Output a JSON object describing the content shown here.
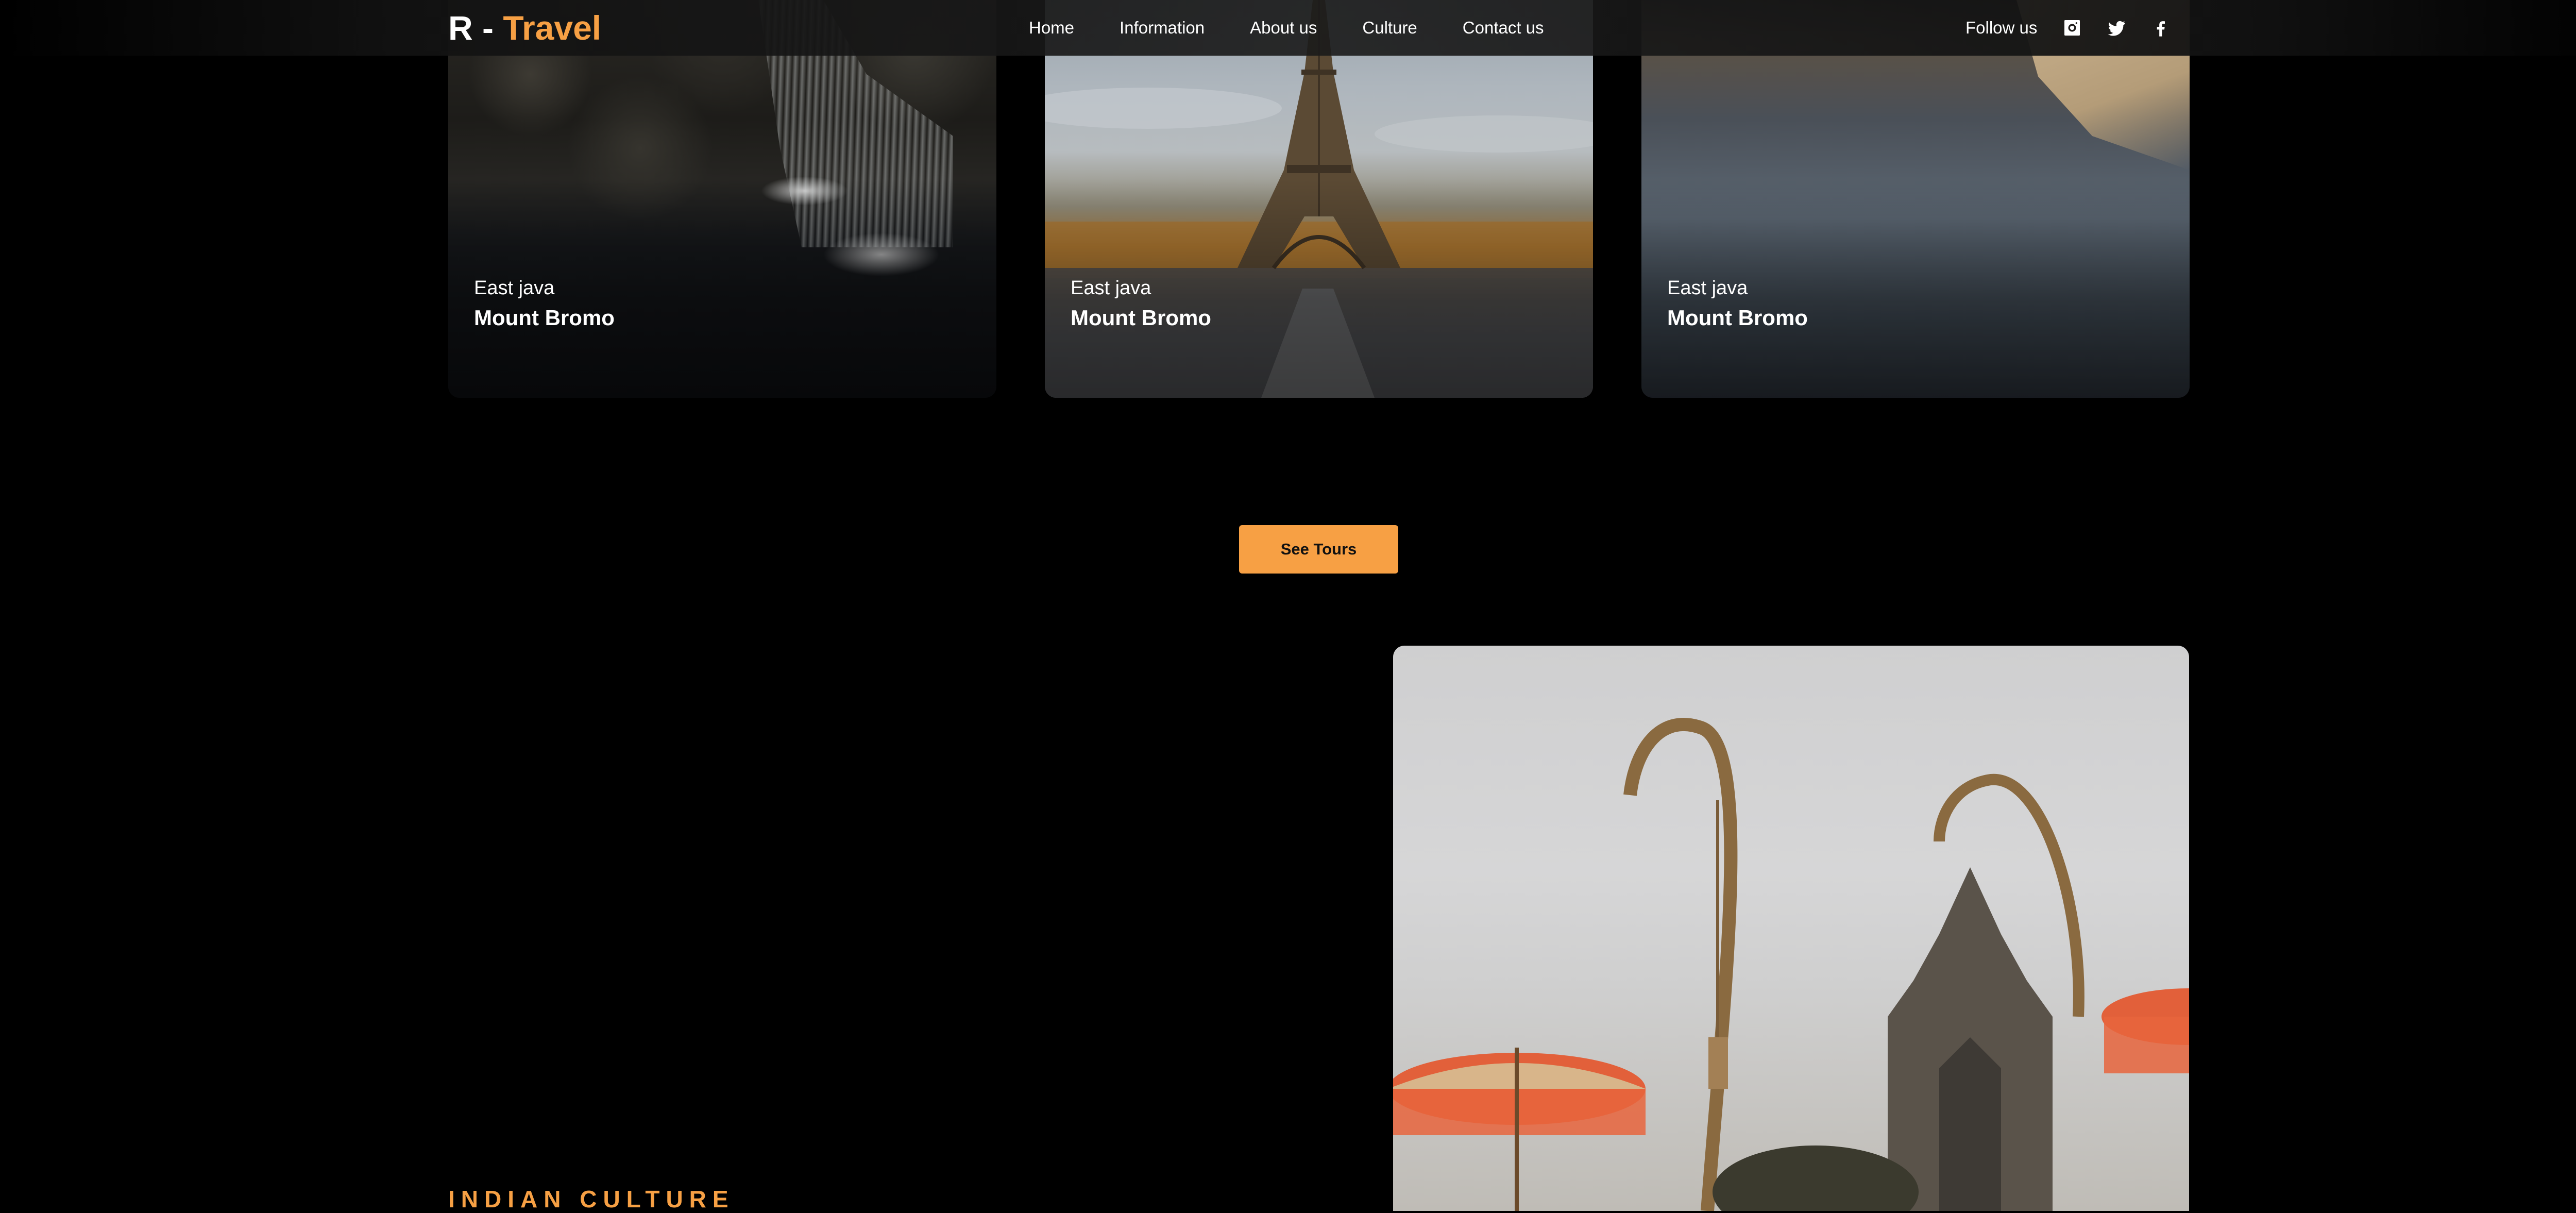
{
  "header": {
    "logo_prefix": "R - ",
    "logo_accent": "Travel",
    "nav": [
      "Home",
      "Information",
      "About us",
      "Culture",
      "Contact us"
    ],
    "follow_label": "Follow us",
    "social_icons": [
      "instagram-icon",
      "twitter-icon",
      "facebook-icon"
    ]
  },
  "cards": [
    {
      "region": "East java",
      "place": "Mount Bromo",
      "photo": "waterfall-photo"
    },
    {
      "region": "East java",
      "place": "Mount Bromo",
      "photo": "eiffel-tower-photo"
    },
    {
      "region": "East java",
      "place": "Mount Bromo",
      "photo": "river-reflection-photo"
    }
  ],
  "cta": {
    "label": "See Tours"
  },
  "culture": {
    "label": "INDIAN CULTURE",
    "photo": "temple-penjor-photo"
  },
  "colors": {
    "accent": "#f7a044",
    "background": "#000000",
    "text": "#ffffff"
  }
}
